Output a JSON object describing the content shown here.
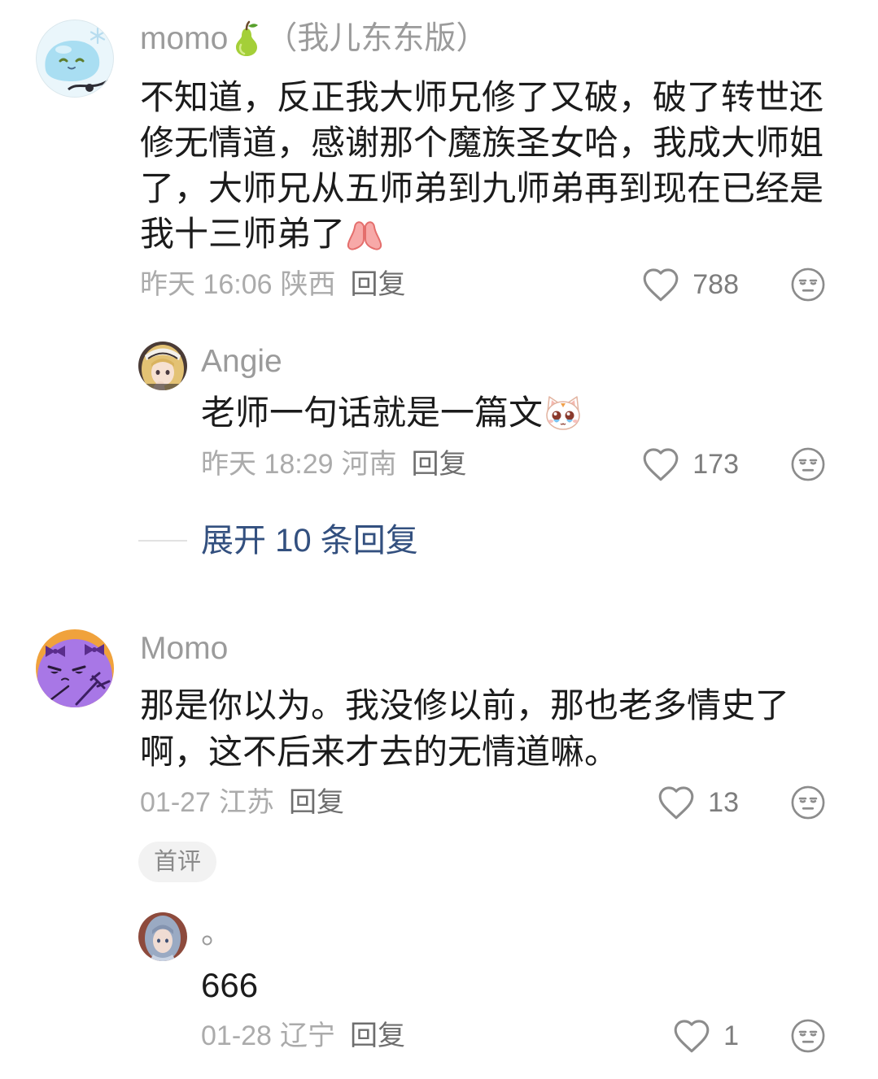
{
  "colors": {
    "text": "#1b1b1b",
    "username": "#9b9b9b",
    "meta": "#ababab",
    "reply_label": "#6e6e6e",
    "like_count": "#7d7d7d",
    "icon": "#8c8c8c",
    "expand_link": "#33507f",
    "badge_bg": "#f2f2f2",
    "badge_text": "#8a8a8a",
    "divider": "#e2e2e2",
    "background": "#ffffff"
  },
  "icons": {
    "like": "heart-outline-icon",
    "dislike": "meh-face-icon"
  },
  "comments": [
    {
      "avatar": "blue-slime-avatar",
      "username": "momo",
      "username_emoji": "pear-emoji-icon",
      "username_suffix": "（我儿东东版）",
      "text": "不知道，反正我大师兄修了又破，破了转世还修无情道，感谢那个魔族圣女哈，我成大师姐了，大师兄从五师弟到九师弟再到现在已经是我十三师弟了",
      "text_emoji": "praying-hands-emoji-icon",
      "time": "昨天 16:06",
      "location": "陕西",
      "reply_label": "回复",
      "likes": 788,
      "replies": [
        {
          "avatar": "anime-blonde-maid-avatar",
          "username": "Angie",
          "text": "老师一句话就是一篇文",
          "text_emoji": "crying-cat-emoji-icon",
          "time": "昨天 18:29",
          "location": "河南",
          "reply_label": "回复",
          "likes": 173
        }
      ],
      "expand_replies_label": "展开 10 条回复"
    },
    {
      "avatar": "purple-devil-avatar",
      "username": "Momo",
      "text": "那是你以为。我没修以前，那也老多情史了啊，这不后来才去的无情道嘛。",
      "time": "01-27",
      "location": "江苏",
      "reply_label": "回复",
      "likes": 13,
      "badge": "首评",
      "replies": [
        {
          "avatar": "anime-blue-hair-avatar",
          "username": "。",
          "text": "666",
          "time": "01-28",
          "location": "辽宁",
          "reply_label": "回复",
          "likes": 1
        }
      ]
    }
  ]
}
